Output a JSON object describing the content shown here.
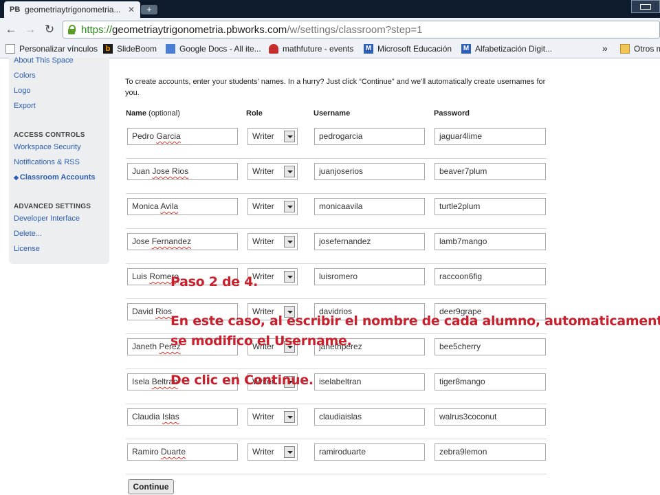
{
  "browser": {
    "tab_title": "geometriaytrigonometria...",
    "tab_favicon": "PB",
    "url_scheme": "https://",
    "url_host": "geometriaytrigonometria.pbworks.com",
    "url_path": "/w/settings/classroom?step=1",
    "bookmarks": [
      {
        "label": "Personalizar vínculos",
        "icon": "page-icon"
      },
      {
        "label": "SlideBoom",
        "icon": "slideboom-icon"
      },
      {
        "label": "Google Docs - All ite...",
        "icon": "google-docs-icon"
      },
      {
        "label": "mathfuture - events",
        "icon": "mathfuture-icon"
      },
      {
        "label": "Microsoft Educación",
        "icon": "microsoft-icon"
      },
      {
        "label": "Alfabetización Digit...",
        "icon": "microsoft-icon"
      }
    ],
    "bookmarks_more": "»",
    "other_bookmarks": "Otros m"
  },
  "sidebar": {
    "links_top": [
      "About This Space",
      "Colors",
      "Logo",
      "Export"
    ],
    "access_heading": "ACCESS CONTROLS",
    "access_links": [
      "Workspace Security",
      "Notifications & RSS"
    ],
    "active_arrow": "◆",
    "active_link": "Classroom Accounts",
    "advanced_heading": "ADVANCED SETTINGS",
    "advanced_links": [
      "Developer Interface",
      "Delete...",
      "License"
    ]
  },
  "main": {
    "intro": "To create accounts, enter your students' names. In a hurry? Just click “Continue” and we'll automatically create usernames for you.",
    "col_name": "Name",
    "col_name_note": " (optional)",
    "col_role": "Role",
    "col_username": "Username",
    "col_password": "Password",
    "rows": [
      {
        "first": "Pedro",
        "last": "Garcia",
        "role": "Writer",
        "username": "pedrogarcia",
        "password": "jaguar4lime"
      },
      {
        "first": "Juan",
        "last": "Jose Rios",
        "role": "Writer",
        "username": "juanjoserios",
        "password": "beaver7plum"
      },
      {
        "first": "Monica",
        "last": "Avila",
        "role": "Writer",
        "username": "monicaavila",
        "password": "turtle2plum"
      },
      {
        "first": "Jose",
        "last": "Fernandez",
        "role": "Writer",
        "username": "josefernandez",
        "password": "lamb7mango"
      },
      {
        "first": "Luis",
        "last": "Romero",
        "role": "Writer",
        "username": "luisromero",
        "password": "raccoon6fig"
      },
      {
        "first": "David",
        "last": "Rios",
        "role": "Writer",
        "username": "davidrios",
        "password": "deer9grape"
      },
      {
        "first": "Janeth",
        "last": "Perez",
        "role": "Writer",
        "username": "janethperez",
        "password": "bee5cherry"
      },
      {
        "first": "Isela",
        "last": "Beltran",
        "role": "Writer",
        "username": "iselabeltran",
        "password": "tiger8mango"
      },
      {
        "first": "Claudia",
        "last": "Islas",
        "role": "Writer",
        "username": "claudiaislas",
        "password": "walrus3coconut"
      },
      {
        "first": "Ramiro",
        "last": "Duarte",
        "role": "Writer",
        "username": "ramiroduarte",
        "password": "zebra9lemon"
      }
    ],
    "continue_label": "Continue"
  },
  "annotation": {
    "step": "Paso 2 de 4.",
    "line1": "En este caso, al escribir el nombre de cada alumno, automaticamente",
    "line2": "se modifico el Username.",
    "instruction": "De clic en Continue."
  },
  "colors": {
    "link": "#2a5db0",
    "annotation": "#c8202c",
    "url_scheme": "#2c8a1f"
  }
}
